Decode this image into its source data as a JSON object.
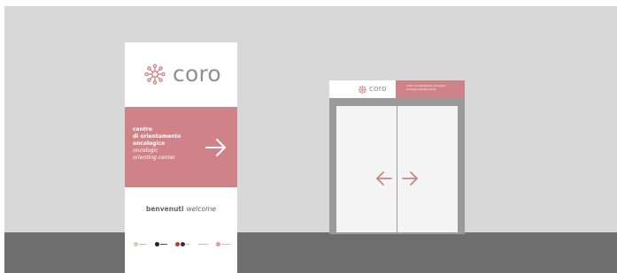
{
  "totem": {
    "logo": "coro",
    "band_lines": [
      "centro",
      "di orientamento",
      "oncologico"
    ],
    "band_lines_en": [
      "oncologic",
      "orienting center"
    ],
    "welcome": "benvenuti",
    "welcome_en": "welcome"
  },
  "door_sign": {
    "logo": "coro",
    "lines": [
      "centro di orientamento oncologico",
      "oncologic orienting center"
    ]
  },
  "colors": {
    "accent": "#cf8287",
    "wall": "#d7d8d7",
    "floor": "#6e6e6e",
    "frame": "#9a9a9a",
    "logo_text": "#8f8f8f"
  },
  "icons": [
    "coro-molecule-logo-icon",
    "arrow-right-icon",
    "arrow-left-icon",
    "partner-logos"
  ]
}
